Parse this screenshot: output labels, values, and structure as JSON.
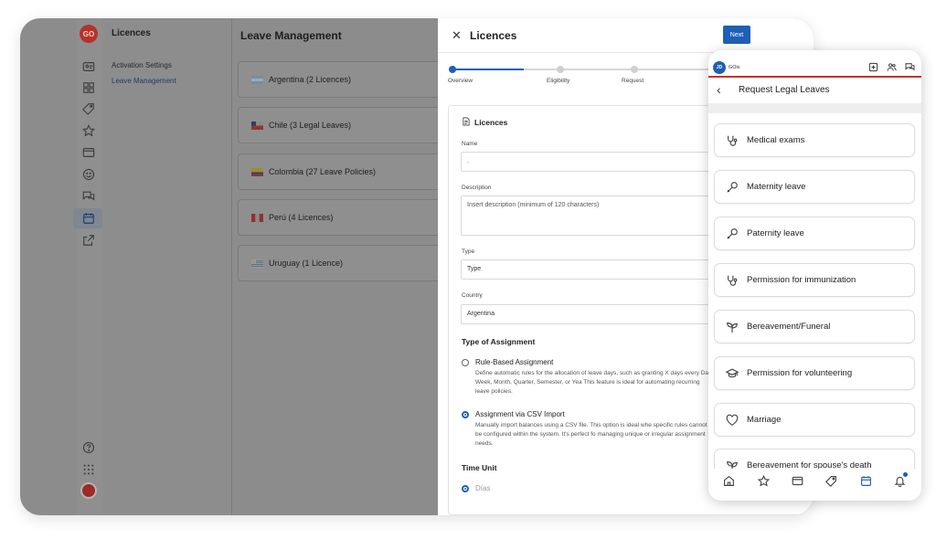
{
  "app": {
    "logo_text": "GO",
    "subnav_title": "Licences",
    "subnav_items": [
      {
        "label": "Activation Settings"
      },
      {
        "label": "Leave Management"
      }
    ],
    "main_title": "Leave Management",
    "countries": [
      {
        "label": "Argentina (2 Licences)",
        "flag": "argentina-flag"
      },
      {
        "label": "Chile (3 Legal Leaves)",
        "flag": "chile-flag"
      },
      {
        "label": "Colombia (27 Leave Policies)",
        "flag": "colombia-flag"
      },
      {
        "label": "Perú (4 Licences)",
        "flag": "peru-flag"
      },
      {
        "label": "Uruguay (1 Licence)",
        "flag": "uruguay-flag"
      }
    ]
  },
  "drawer": {
    "title": "Licences",
    "next_label": "Next",
    "steps": [
      {
        "label": "Overview"
      },
      {
        "label": "Eligibility"
      },
      {
        "label": "Request"
      }
    ],
    "form": {
      "title": "Licences",
      "name_label": "Name",
      "name_value": ".",
      "description_label": "Description",
      "description_placeholder": "Insert description (minimum of 120 characters)",
      "type_label": "Type",
      "type_value": "Type",
      "country_label": "Country",
      "country_value": "Argentina",
      "assignment_title": "Type of Assignment",
      "options": [
        {
          "label": "Rule-Based Assignment",
          "desc": "Define automatic rules for the allocation of leave days, such as granting X days every Day, Week, Month, Quarter, Semester, or Yea This feature is ideal for automating recurring leave policies.",
          "checked": false
        },
        {
          "label": "Assignment via CSV Import",
          "desc": "Manually import balances using a CSV file. This option is ideal whe specific rules cannot be configured within the system. It's perfect fo managing unique or irregular assignment needs.",
          "checked": true
        }
      ],
      "time_unit_title": "Time Unit",
      "time_unit_option": "Días"
    }
  },
  "phone": {
    "avatar": "JD",
    "brand": "GOis",
    "title": "Request Legal Leaves",
    "items": [
      {
        "label": "Medical exams",
        "icon": "stethoscope-icon"
      },
      {
        "label": "Maternity leave",
        "icon": "rattle-icon"
      },
      {
        "label": "Paternity leave",
        "icon": "rattle-icon"
      },
      {
        "label": "Permission for immunization",
        "icon": "stethoscope-icon"
      },
      {
        "label": "Bereavement/Funeral",
        "icon": "sprout-icon"
      },
      {
        "label": "Permission for volunteering",
        "icon": "graduation-cap-icon"
      },
      {
        "label": "Marriage",
        "icon": "heart-icon"
      },
      {
        "label": "Bereavement for spouse's death",
        "icon": "sprout-icon"
      }
    ],
    "accent": "#1f5fb5",
    "header_rule": "#c9302c"
  }
}
